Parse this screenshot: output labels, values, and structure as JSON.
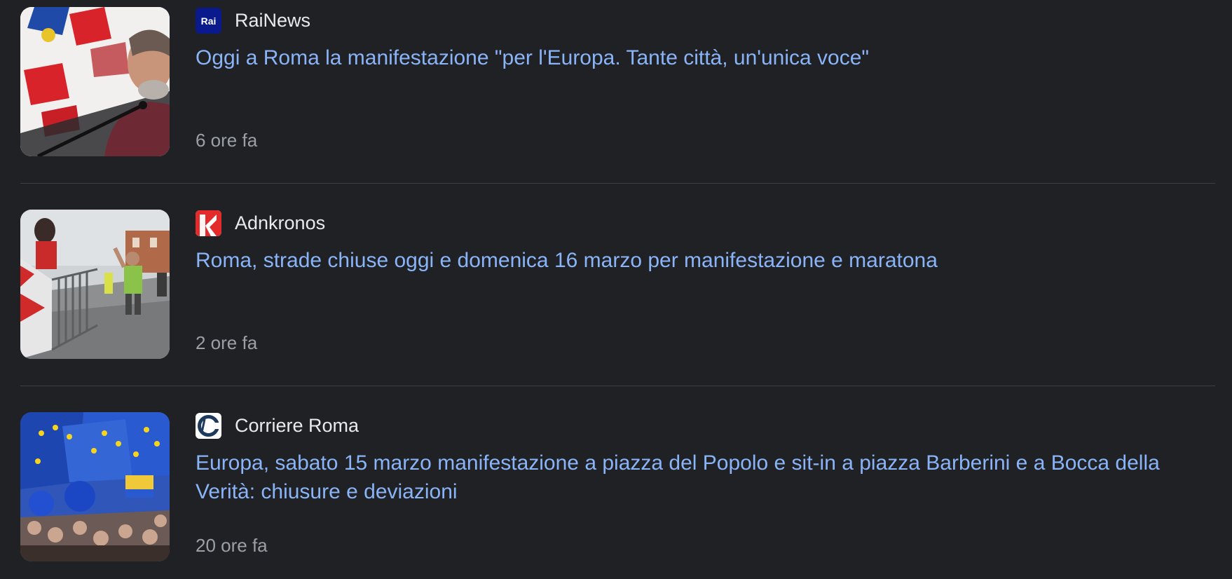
{
  "articles": [
    {
      "source": "RaiNews",
      "source_icon": "rai-logo-icon",
      "source_icon_text": "Rai",
      "title": "Oggi a Roma la manifestazione \"per l'Europa. Tante città, un'unica voce\"",
      "time": "6 ore fa",
      "thumbnail": "man-at-microphone-photo"
    },
    {
      "source": "Adnkronos",
      "source_icon": "adnkronos-logo-icon",
      "title": "Roma, strade chiuse oggi e domenica 16 marzo per manifestazione e maratona",
      "time": "2 ore fa",
      "thumbnail": "marathon-runners-photo"
    },
    {
      "source": "Corriere Roma",
      "source_icon": "corriere-logo-icon",
      "title": "Europa, sabato 15 marzo manifestazione a piazza del Popolo e sit-in a piazza Barberini e a Bocca della Verità: chiusure e deviazioni",
      "time": "20 ore fa",
      "thumbnail": "eu-flags-crowd-photo"
    }
  ],
  "colors": {
    "background": "#202124",
    "headline": "#8ab4f8",
    "source": "#e8eaed",
    "time": "#9aa0a6",
    "divider": "#3c4043"
  }
}
